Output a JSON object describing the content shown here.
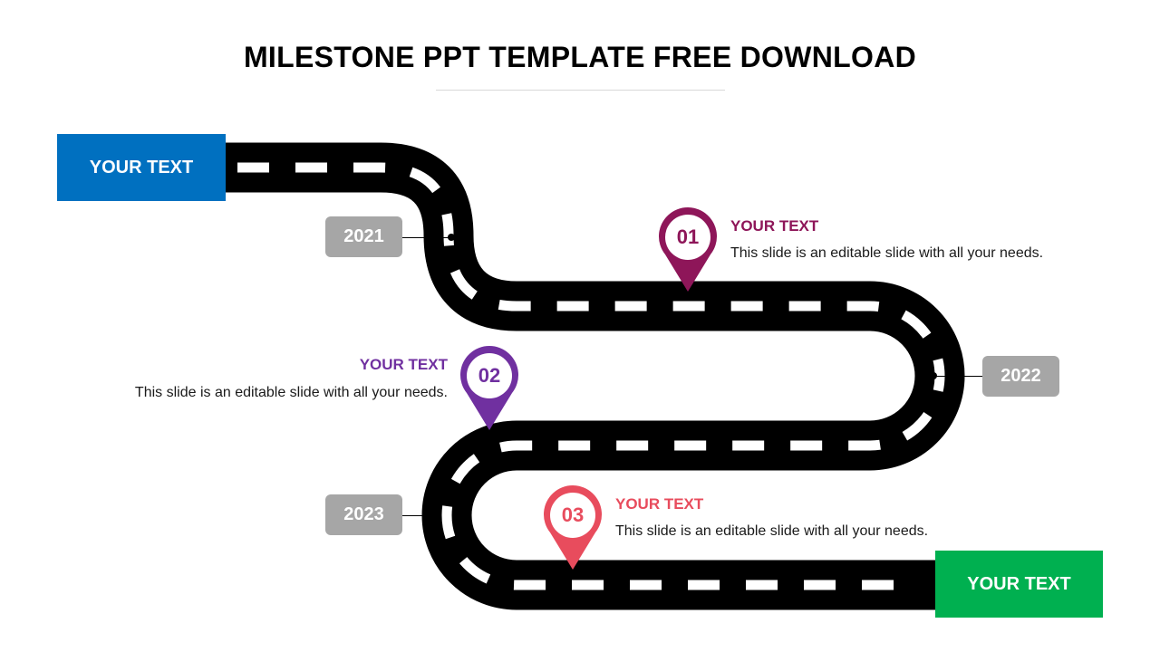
{
  "title": "MILESTONE PPT TEMPLATE FREE DOWNLOAD",
  "colors": {
    "start_box": "#0070c0",
    "end_box": "#00b050",
    "year_badge": "#a6a6a6",
    "road": "#000000",
    "road_dash": "#ffffff",
    "milestone_01": "#8e1659",
    "milestone_02": "#7030a0",
    "milestone_03": "#e84c5d"
  },
  "start_box": {
    "label": "YOUR TEXT"
  },
  "end_box": {
    "label": "YOUR TEXT"
  },
  "years": [
    {
      "label": "2021"
    },
    {
      "label": "2022"
    },
    {
      "label": "2023"
    }
  ],
  "milestones": [
    {
      "number": "01",
      "title": "YOUR TEXT",
      "body": "This slide is an editable slide with all your needs."
    },
    {
      "number": "02",
      "title": "YOUR TEXT",
      "body": "This slide is an editable slide with all your needs."
    },
    {
      "number": "03",
      "title": "YOUR TEXT",
      "body": "This slide is an editable slide with all your needs."
    }
  ]
}
